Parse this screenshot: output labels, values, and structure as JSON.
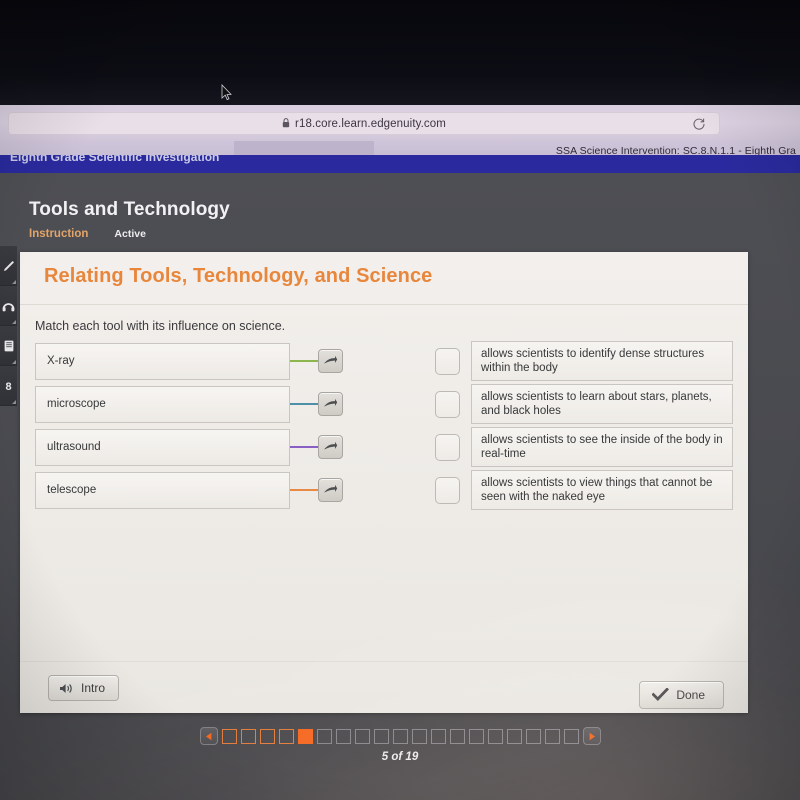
{
  "browser": {
    "url": "r18.core.learn.edgenuity.com",
    "lock_icon": "lock-icon",
    "reload_icon": "reload-icon",
    "tab_title": "SSA Science Intervention: SC.8.N.1.1 - Eighth Gra"
  },
  "app_header": {
    "course_band_title": "Eighth Grade Scientific Investigation"
  },
  "lesson": {
    "title": "Tools and Technology",
    "section_label": "Instruction",
    "state_label": "Active"
  },
  "card": {
    "title": "Relating Tools, Technology, and Science",
    "prompt": "Match each tool with its influence on science."
  },
  "matching": {
    "tools": [
      {
        "label": "X-ray",
        "connector_color": "#8cb74e",
        "arrow_icon": "arrow-right-icon"
      },
      {
        "label": "microscope",
        "connector_color": "#4f8fa8",
        "arrow_icon": "arrow-right-icon"
      },
      {
        "label": "ultrasound",
        "connector_color": "#8a5fc4",
        "arrow_icon": "arrow-right-icon"
      },
      {
        "label": "telescope",
        "connector_color": "#e88a46",
        "arrow_icon": "arrow-right-icon"
      }
    ],
    "descriptions": [
      "allows scientists to identify dense structures within the body",
      "allows scientists to learn about stars, planets, and black holes",
      "allows scientists to see the inside of the body in real-time",
      "allows scientists to view things that cannot be seen with the naked eye"
    ]
  },
  "footer": {
    "intro_label": "Intro",
    "intro_icon": "speaker-icon",
    "done_label": "Done",
    "done_icon": "checkmark-icon"
  },
  "progress": {
    "prev_icon": "triangle-left-icon",
    "next_icon": "triangle-right-icon",
    "page_text": "5 of 19",
    "total_steps": 19,
    "current_step": 5,
    "accent_color": "#f4641d"
  },
  "left_toolbar": {
    "items": [
      {
        "icon": "pencil-icon"
      },
      {
        "icon": "headphones-icon"
      },
      {
        "icon": "notebook-icon"
      },
      {
        "icon": "calculator-icon"
      }
    ]
  },
  "cursor": {
    "icon": "mouse-pointer-icon"
  }
}
